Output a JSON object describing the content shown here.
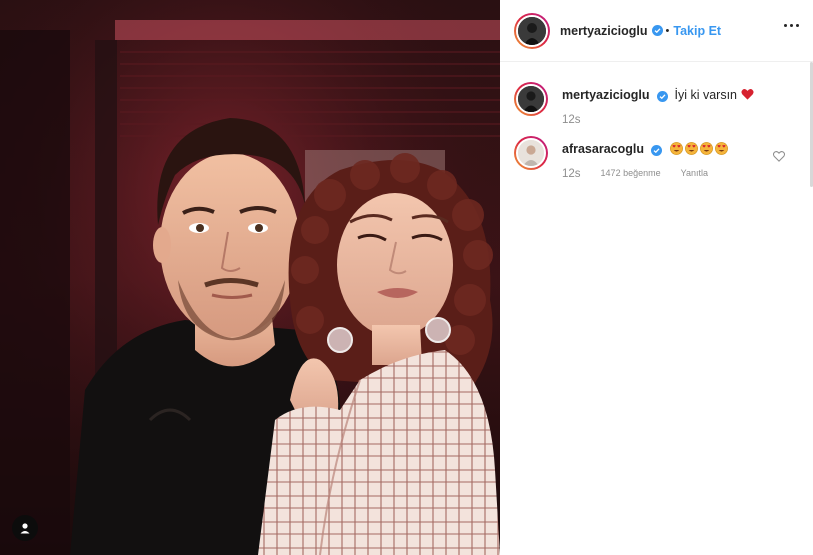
{
  "post": {
    "author": {
      "username": "mertyazicioglu",
      "verified": true,
      "follow_label": "Takip Et",
      "separator": "•"
    },
    "more_options_icon": "more-horizontal-icon",
    "photo": {
      "description_icon": "user-tag-icon"
    }
  },
  "comments": [
    {
      "username": "mertyazicioglu",
      "verified": true,
      "text": "İyi ki varsın",
      "trailing_emoji": "red-heart",
      "time": "12s"
    },
    {
      "username": "afrasaracoglu",
      "verified": true,
      "emojis": [
        "heart-eyes",
        "heart-eyes",
        "heart-eyes",
        "heart-eyes"
      ],
      "time": "12s",
      "likes_label": "1472 beğenme",
      "reply_label": "Yanıtla",
      "like_icon": "heart-outline-icon"
    }
  ],
  "colors": {
    "accent": "#3897f0",
    "text": "#262626",
    "muted": "#8e8e8e",
    "heart": "#ed4956"
  }
}
